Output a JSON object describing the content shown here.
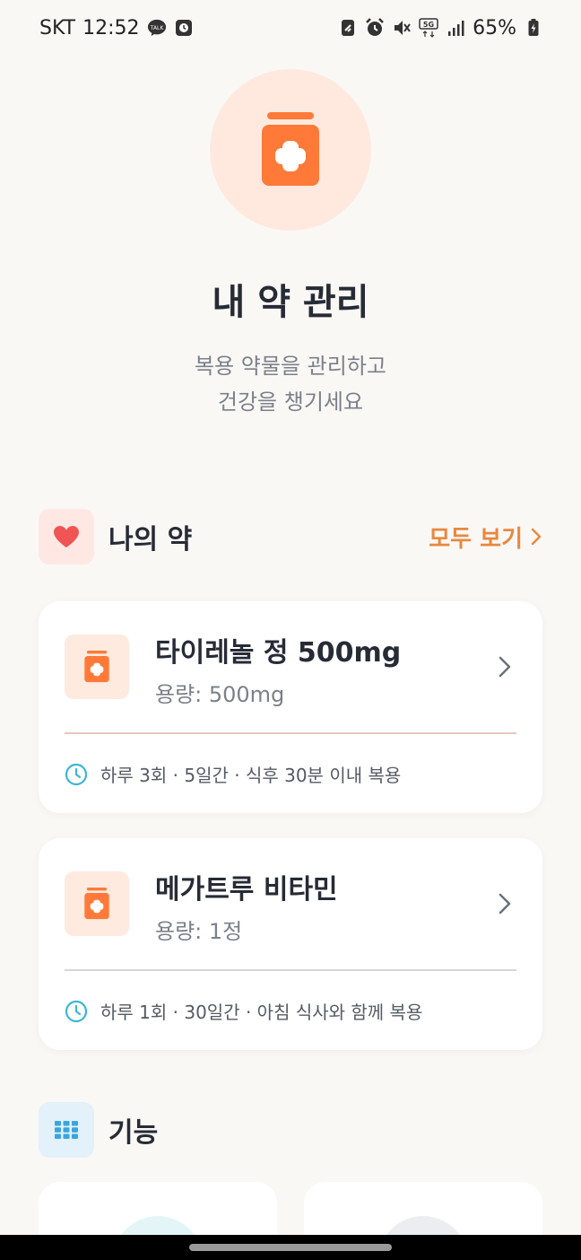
{
  "status_bar": {
    "carrier": "SKT",
    "time": "12:52",
    "talk_badge": "TALK",
    "network": "5G",
    "battery": "65%"
  },
  "header": {
    "title": "내 약 관리",
    "subtitle_line1": "복용 약물을 관리하고",
    "subtitle_line2": "건강을 챙기세요"
  },
  "my_meds": {
    "title": "나의 약",
    "see_all": "모두 보기",
    "items": [
      {
        "name": "타이레놀 정 500mg",
        "dose": "용량: 500mg",
        "schedule": "하루 3회 · 5일간 · 식후 30분 이내 복용",
        "divider_color": "#E5C9BD"
      },
      {
        "name": "메가트루 비타민",
        "dose": "용량: 1정",
        "schedule": "하루 1회 · 30일간 · 아침 식사와 함께 복용",
        "divider_color": "#D6D6D6"
      }
    ]
  },
  "features": {
    "title": "기능"
  },
  "colors": {
    "accent": "#FF7A38",
    "accent_text": "#E8893F",
    "heart": "#F05454",
    "clock": "#3DB5D6",
    "grid": "#3AA6DD"
  }
}
